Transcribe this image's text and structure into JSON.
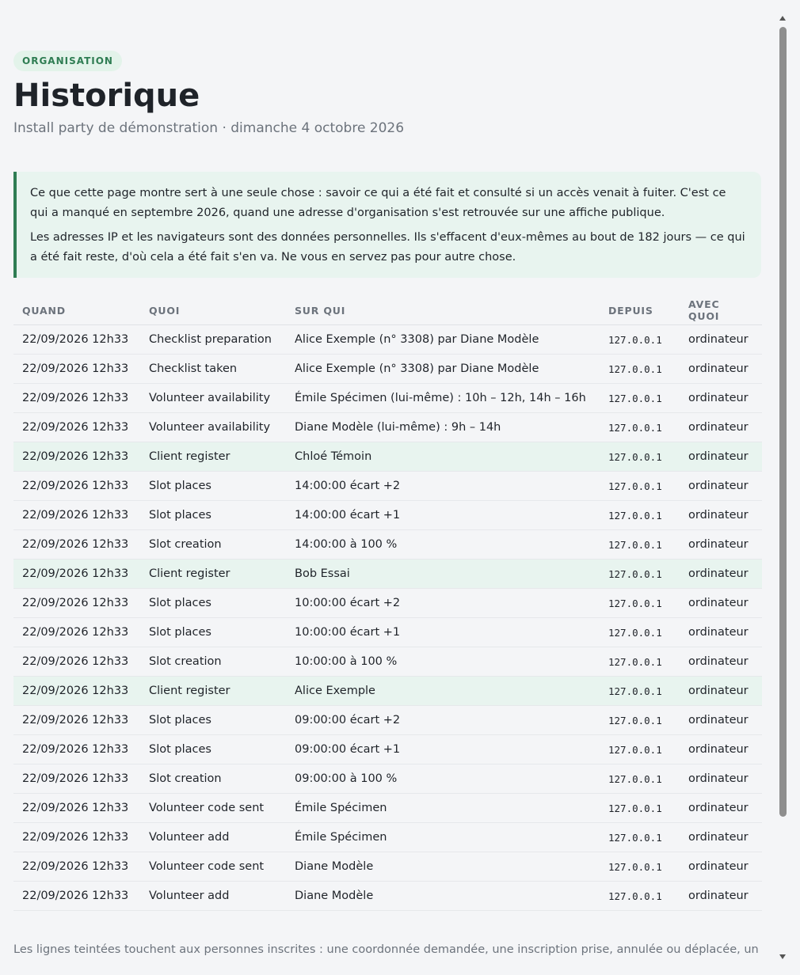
{
  "header": {
    "badge": "ORGANISATION",
    "title": "Historique",
    "subtitle": "Install party de démonstration · dimanche 4 octobre 2026"
  },
  "notice": {
    "p1": "Ce que cette page montre sert à une seule chose : savoir ce qui a été fait et consulté si un accès venait à fuiter. C'est ce qui a manqué en septembre 2026, quand une adresse d'organisation s'est retrouvée sur une affiche publique.",
    "p2": "Les adresses IP et les navigateurs sont des données personnelles. Ils s'effacent d'eux-mêmes au bout de 182 jours — ce qui a été fait reste, d'où cela a été fait s'en va. Ne vous en servez pas pour autre chose."
  },
  "table": {
    "columns": [
      "QUAND",
      "QUOI",
      "SUR QUI",
      "DEPUIS",
      "AVEC QUOI"
    ],
    "rows": [
      {
        "when": "22/09/2026 12h33",
        "what": "Checklist preparation",
        "who": "Alice Exemple (n° 3308) par Diane Modèle",
        "from": "127.0.0.1",
        "with": "ordinateur",
        "tinted": false
      },
      {
        "when": "22/09/2026 12h33",
        "what": "Checklist taken",
        "who": "Alice Exemple (n° 3308) par Diane Modèle",
        "from": "127.0.0.1",
        "with": "ordinateur",
        "tinted": false
      },
      {
        "when": "22/09/2026 12h33",
        "what": "Volunteer availability",
        "who": "Émile Spécimen (lui-même) : 10h – 12h, 14h – 16h",
        "from": "127.0.0.1",
        "with": "ordinateur",
        "tinted": false
      },
      {
        "when": "22/09/2026 12h33",
        "what": "Volunteer availability",
        "who": "Diane Modèle (lui-même) : 9h – 14h",
        "from": "127.0.0.1",
        "with": "ordinateur",
        "tinted": false
      },
      {
        "when": "22/09/2026 12h33",
        "what": "Client register",
        "who": "Chloé Témoin",
        "from": "127.0.0.1",
        "with": "ordinateur",
        "tinted": true
      },
      {
        "when": "22/09/2026 12h33",
        "what": "Slot places",
        "who": "14:00:00 écart +2",
        "from": "127.0.0.1",
        "with": "ordinateur",
        "tinted": false
      },
      {
        "when": "22/09/2026 12h33",
        "what": "Slot places",
        "who": "14:00:00 écart +1",
        "from": "127.0.0.1",
        "with": "ordinateur",
        "tinted": false
      },
      {
        "when": "22/09/2026 12h33",
        "what": "Slot creation",
        "who": "14:00:00 à 100 %",
        "from": "127.0.0.1",
        "with": "ordinateur",
        "tinted": false
      },
      {
        "when": "22/09/2026 12h33",
        "what": "Client register",
        "who": "Bob Essai",
        "from": "127.0.0.1",
        "with": "ordinateur",
        "tinted": true
      },
      {
        "when": "22/09/2026 12h33",
        "what": "Slot places",
        "who": "10:00:00 écart +2",
        "from": "127.0.0.1",
        "with": "ordinateur",
        "tinted": false
      },
      {
        "when": "22/09/2026 12h33",
        "what": "Slot places",
        "who": "10:00:00 écart +1",
        "from": "127.0.0.1",
        "with": "ordinateur",
        "tinted": false
      },
      {
        "when": "22/09/2026 12h33",
        "what": "Slot creation",
        "who": "10:00:00 à 100 %",
        "from": "127.0.0.1",
        "with": "ordinateur",
        "tinted": false
      },
      {
        "when": "22/09/2026 12h33",
        "what": "Client register",
        "who": "Alice Exemple",
        "from": "127.0.0.1",
        "with": "ordinateur",
        "tinted": true
      },
      {
        "when": "22/09/2026 12h33",
        "what": "Slot places",
        "who": "09:00:00 écart +2",
        "from": "127.0.0.1",
        "with": "ordinateur",
        "tinted": false
      },
      {
        "when": "22/09/2026 12h33",
        "what": "Slot places",
        "who": "09:00:00 écart +1",
        "from": "127.0.0.1",
        "with": "ordinateur",
        "tinted": false
      },
      {
        "when": "22/09/2026 12h33",
        "what": "Slot creation",
        "who": "09:00:00 à 100 %",
        "from": "127.0.0.1",
        "with": "ordinateur",
        "tinted": false
      },
      {
        "when": "22/09/2026 12h33",
        "what": "Volunteer code sent",
        "who": "Émile Spécimen",
        "from": "127.0.0.1",
        "with": "ordinateur",
        "tinted": false
      },
      {
        "when": "22/09/2026 12h33",
        "what": "Volunteer add",
        "who": "Émile Spécimen",
        "from": "127.0.0.1",
        "with": "ordinateur",
        "tinted": false
      },
      {
        "when": "22/09/2026 12h33",
        "what": "Volunteer code sent",
        "who": "Diane Modèle",
        "from": "127.0.0.1",
        "with": "ordinateur",
        "tinted": false
      },
      {
        "when": "22/09/2026 12h33",
        "what": "Volunteer add",
        "who": "Diane Modèle",
        "from": "127.0.0.1",
        "with": "ordinateur",
        "tinted": false
      }
    ]
  },
  "footer": {
    "text": "Les lignes teintées touchent aux personnes inscrites : une coordonnée demandée, une inscription prise, annulée ou déplacée, un"
  },
  "colors": {
    "accent": "#2f7d53",
    "tint": "#e8f4ef",
    "badge_bg": "#e3f3ea"
  }
}
